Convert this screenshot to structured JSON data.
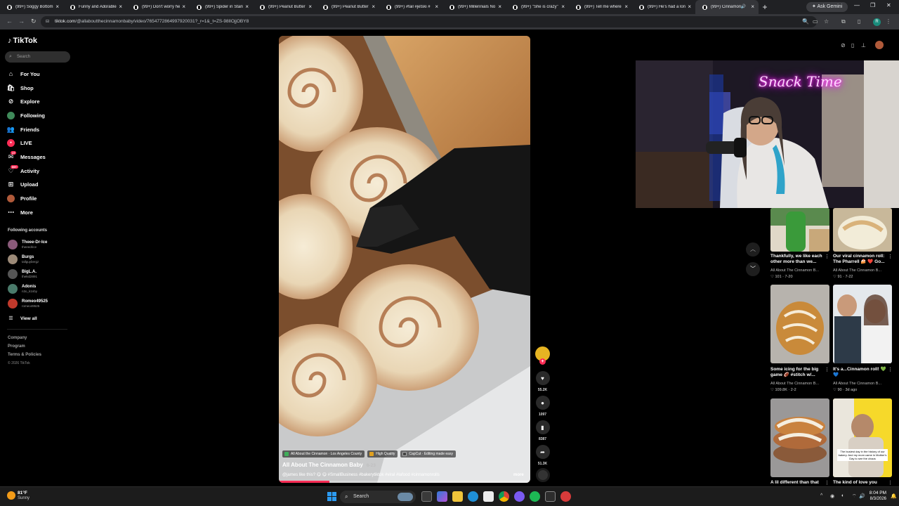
{
  "browser": {
    "tabs": [
      {
        "title": "(99+) Soggy Bottom"
      },
      {
        "title": "Funny and Adorable"
      },
      {
        "title": "(99+) Don't worry he"
      },
      {
        "title": "(99+) Spider in Stanki"
      },
      {
        "title": "(99+) Peanut Butter"
      },
      {
        "title": "(99+) Peanut Butter"
      },
      {
        "title": "(99+) #fail #jetski #"
      },
      {
        "title": "(99+) Millennials No"
      },
      {
        "title": "(99+) \"She is crazy\""
      },
      {
        "title": "(99+) Tell me where"
      },
      {
        "title": "(99+) He's had a lon"
      },
      {
        "title": "(99+) Cinnamon"
      }
    ],
    "ask_gemini": "Ask Gemini",
    "url_host": "tiktok.com",
    "url_path": "/@allaboutthecinnamonbaby/video/7654772864997920031?_r=1&_t=ZS-98lIOjjOBY8",
    "profile_initial": "R"
  },
  "sidebar": {
    "logo": "TikTok",
    "search_placeholder": "Search",
    "nav": [
      {
        "label": "For You",
        "icon": "home-icon"
      },
      {
        "label": "Shop",
        "icon": "shop-icon"
      },
      {
        "label": "Explore",
        "icon": "compass-icon"
      },
      {
        "label": "Following",
        "icon": "following-icon"
      },
      {
        "label": "Friends",
        "icon": "friends-icon"
      },
      {
        "label": "LIVE",
        "icon": "live-icon"
      },
      {
        "label": "Messages",
        "icon": "messages-icon",
        "badge": "17"
      },
      {
        "label": "Activity",
        "icon": "activity-icon",
        "badge": "99+"
      },
      {
        "label": "Upload",
        "icon": "upload-icon"
      },
      {
        "label": "Profile",
        "icon": "profile-icon"
      },
      {
        "label": "More",
        "icon": "more-icon"
      }
    ],
    "following_title": "Following accounts",
    "accounts": [
      {
        "name": "Theee-Dr-Ice",
        "handle": "theeedrice",
        "color": "#8a5a7a"
      },
      {
        "name": "Burgs",
        "handle": "tallguybergz",
        "color": "#9c8a78"
      },
      {
        "name": "BigL.A.",
        "handle": "thekid2891",
        "color": "#555555"
      },
      {
        "name": "Adonis",
        "handle": "n3o_k1nby",
        "color": "#4a7a6a"
      },
      {
        "name": "Romeo49525",
        "handle": "romeo49525",
        "color": "#c0392b"
      }
    ],
    "view_all": "View all",
    "footer": [
      "Company",
      "Program",
      "Terms & Policies"
    ],
    "copyright": "© 2026 TikTok"
  },
  "video": {
    "anchors": [
      {
        "label": "All About the Cinnamon · Los Angeles County",
        "color": "#3fae5a"
      },
      {
        "label": "High Quality",
        "color": "#e0a020"
      },
      {
        "label": "CapCut · Editing made easy",
        "color": "#444444"
      }
    ],
    "author": "All About The Cinnamon Baby",
    "date": "6-23",
    "caption": "@james like this? 😋 😋 #SmallBusiness #bakerytiktok #viral #lafood #cinnamonrolls",
    "more": "more",
    "progress": 0.2
  },
  "actions": {
    "likes": "55.2K",
    "comments": "1097",
    "saves": "8387",
    "shares": "51.3K"
  },
  "stream_overlay": {
    "neon_sign": "Snack Time"
  },
  "related": [
    {
      "title": "Thankfully, we like each other more than we...",
      "author": "All About The Cinnamon B...",
      "likes": "101",
      "date": "7-20"
    },
    {
      "title": "Our viral cinnamon roll: The Pharrell 🍰 ❤️ Go...",
      "author": "All About The Cinnamon B...",
      "likes": "91",
      "date": "7-22"
    },
    {
      "title": "Some icing for the big game 🏈 #stitch w/...",
      "author": "All About The Cinnamon B...",
      "likes": "109.8K",
      "date": "2-2"
    },
    {
      "title": "It's a...Cinnamon roll! 💚 💙",
      "author": "All About The Cinnamon B...",
      "likes": "90",
      "date": "3d ago"
    },
    {
      "title": "A lil different than that",
      "author": "",
      "likes": "",
      "date": ""
    },
    {
      "title": "The kind of love you",
      "author": "",
      "likes": "",
      "date": ""
    }
  ],
  "related_thumb_overlay": "The busiest day in the history of our bakery. And my mom came in Mother's Day to see the chaos",
  "taskbar": {
    "temp": "81°F",
    "condition": "Sunny",
    "search": "Search",
    "time": "8:04 PM",
    "date": "8/3/2026"
  }
}
